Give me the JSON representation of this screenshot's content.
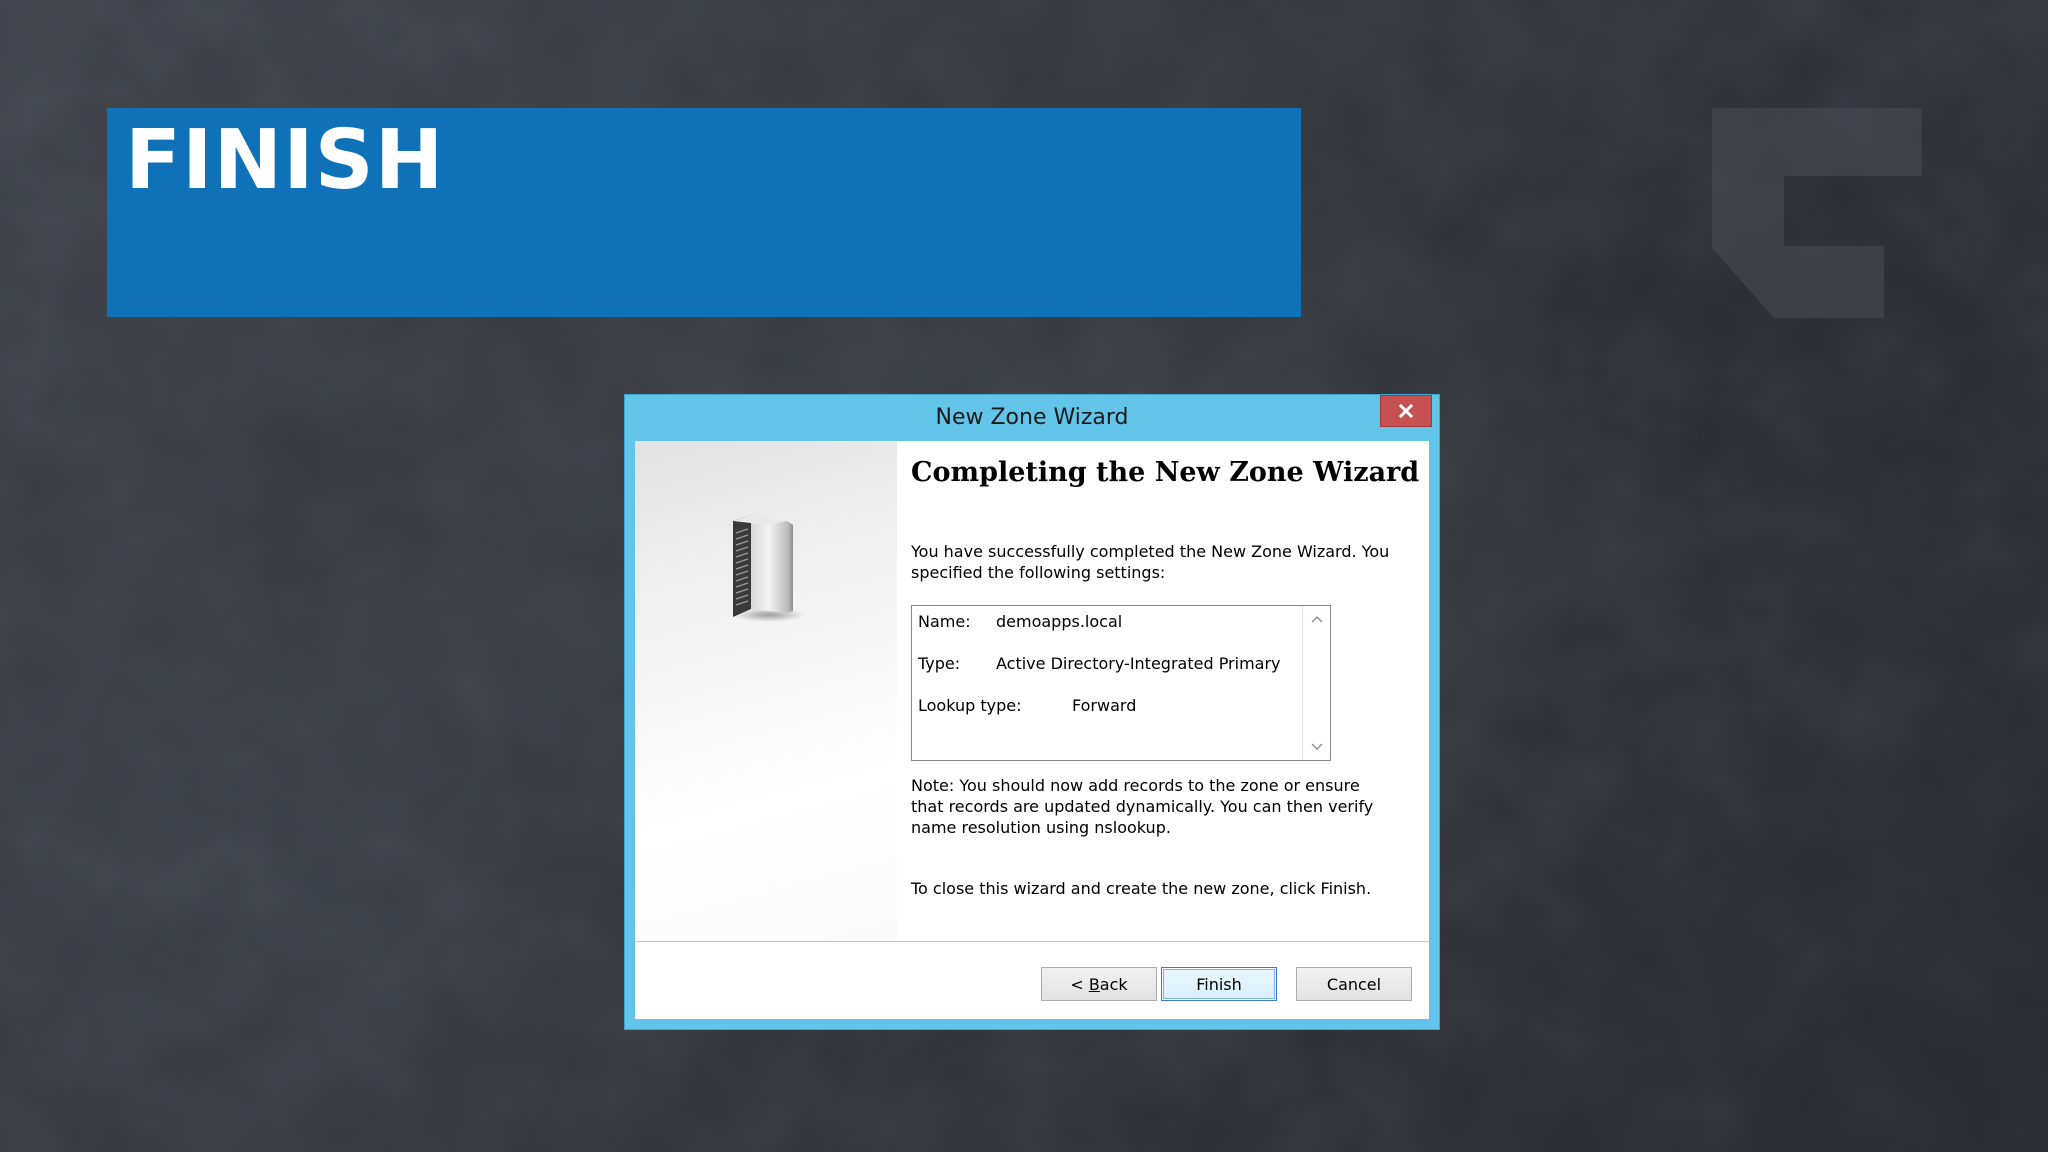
{
  "slide": {
    "title": "FINISH",
    "title_bar_color": "#0f72b8"
  },
  "dialog": {
    "title": "New Zone Wizard",
    "close_glyph": "×",
    "heading": "Completing the New Zone Wizard",
    "intro": "You have successfully completed the New Zone Wizard. You specified the following settings:",
    "settings": {
      "name_label": "Name:",
      "name_value": "demoapps.local",
      "type_label": "Type:",
      "type_value": "Active Directory-Integrated Primary",
      "lookup_label": "Lookup type:",
      "lookup_value": "Forward"
    },
    "note": "Note: You should now add records to the zone or ensure that records are updated dynamically. You can then verify name resolution using nslookup.",
    "close_instruction": "To close this wizard and create the new zone, click Finish.",
    "buttons": {
      "back_prefix": "< ",
      "back_mnemonic": "B",
      "back_rest": "ack",
      "finish": "Finish",
      "cancel": "Cancel"
    },
    "frame_color": "#62c4e8",
    "close_color": "#c75050"
  },
  "icons": {
    "server": "server-icon",
    "close": "close-icon",
    "scroll_up": "chevron-up-icon",
    "scroll_down": "chevron-down-icon",
    "logo": "brand-logo"
  }
}
